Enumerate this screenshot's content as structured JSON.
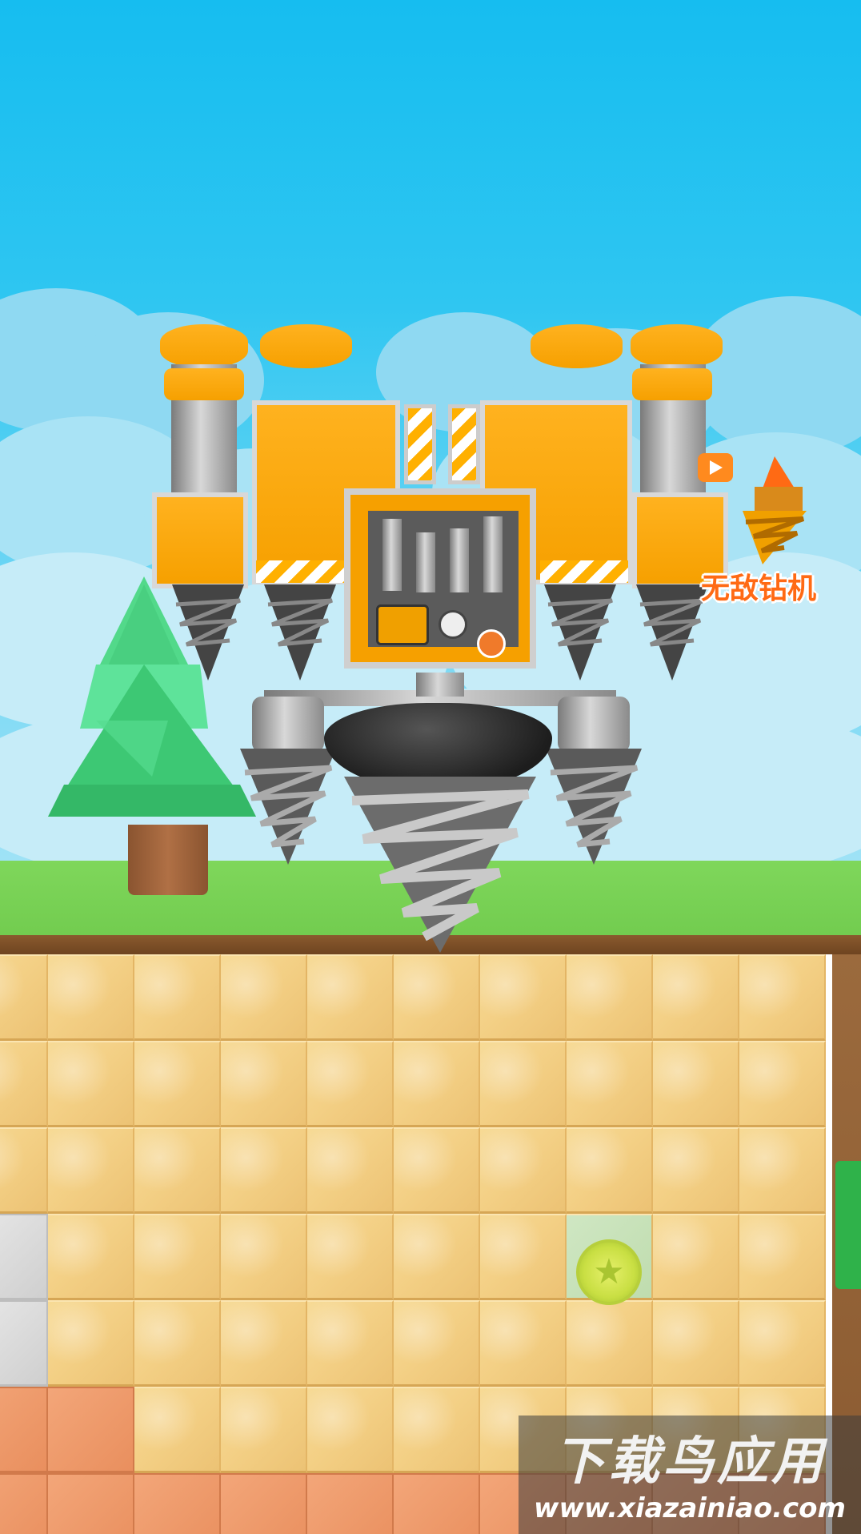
{
  "scene": {
    "sky_color": "#2fc6f1",
    "grass_color": "#7fd75b",
    "block_color": "#f3cf84"
  },
  "badge": {
    "label": "无敌钻机",
    "video_icon": "video-icon",
    "drill_icon": "drill-icon"
  },
  "collectible": {
    "icon": "star-icon",
    "glyph": "★"
  },
  "watermark": {
    "title": "下载鸟应用",
    "url": "www.xiazainiao.com"
  }
}
